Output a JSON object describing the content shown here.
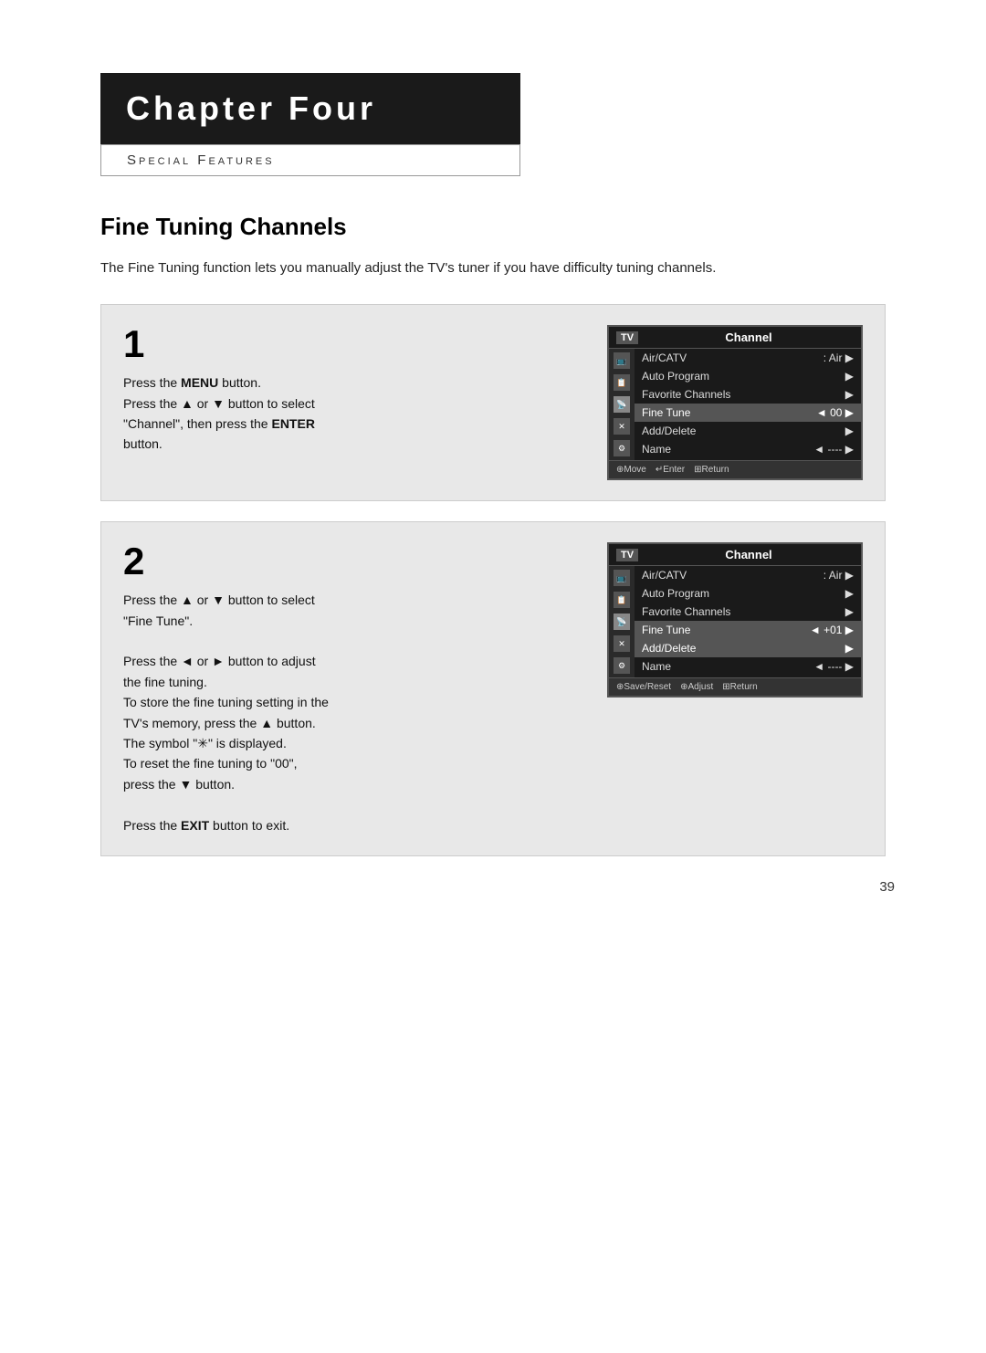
{
  "header": {
    "chapter_title": "Chapter Four",
    "subtitle": "Special Features"
  },
  "section": {
    "title": "Fine Tuning Channels",
    "description": "The Fine Tuning function lets you manually adjust the TV's tuner if you have difficulty tuning channels."
  },
  "step1": {
    "number": "1",
    "text_parts": [
      {
        "type": "normal",
        "text": "Press the "
      },
      {
        "type": "bold",
        "text": "MENU"
      },
      {
        "type": "normal",
        "text": " button."
      },
      {
        "type": "newline"
      },
      {
        "type": "normal",
        "text": "Press the ▲ or ▼ button to select"
      },
      {
        "type": "newline"
      },
      {
        "type": "normal",
        "text": "\"Channel\", then press the "
      },
      {
        "type": "bold",
        "text": "ENTER"
      },
      {
        "type": "newline"
      },
      {
        "type": "normal",
        "text": "button."
      }
    ],
    "menu": {
      "tv_label": "TV",
      "title": "Channel",
      "items": [
        {
          "label": "Air/CATV",
          "value": ": Air",
          "arrow": "right",
          "highlighted": false
        },
        {
          "label": "Auto Program",
          "value": "",
          "arrow": "right",
          "highlighted": false
        },
        {
          "label": "Favorite Channels",
          "value": "",
          "arrow": "right",
          "highlighted": false
        },
        {
          "label": "Fine Tune",
          "value": "◄  00",
          "arrow": "right",
          "highlighted": true
        },
        {
          "label": "Add/Delete",
          "value": "",
          "arrow": "right",
          "highlighted": false
        },
        {
          "label": "Name",
          "value": "◄  ----",
          "arrow": "right",
          "highlighted": false
        }
      ],
      "footer": [
        "⊕Move",
        "↵Enter",
        "⊞Return"
      ]
    }
  },
  "step2": {
    "number": "2",
    "text_lines": [
      "Press the ▲ or ▼ button to select",
      "\"Fine Tune\".",
      "",
      "Press the ◄ or ► button to adjust",
      "the fine tuning.",
      "To store the fine tuning setting in the",
      "TV's memory, press the ▲ button.",
      "The symbol \"✳\" is displayed.",
      "To reset the fine tuning to \"00\",",
      "press the ▼ button.",
      "",
      "Press the EXIT button to exit."
    ],
    "menu": {
      "tv_label": "TV",
      "title": "Channel",
      "items": [
        {
          "label": "Air/CATV",
          "value": ": Air",
          "arrow": "right",
          "highlighted": false
        },
        {
          "label": "Auto Program",
          "value": "",
          "arrow": "right",
          "highlighted": false
        },
        {
          "label": "Favorite Channels",
          "value": "",
          "arrow": "right",
          "highlighted": false
        },
        {
          "label": "Fine Tune",
          "value": "◄  +01",
          "arrow": "right",
          "highlighted": true
        },
        {
          "label": "Add/Delete",
          "value": "",
          "arrow": "right",
          "highlighted": true
        },
        {
          "label": "Name",
          "value": "◄  ----",
          "arrow": "right",
          "highlighted": false
        }
      ],
      "footer": [
        "⊕Save/Reset",
        "⊕Adjust",
        "⊞Return"
      ]
    }
  },
  "page_number": "39"
}
